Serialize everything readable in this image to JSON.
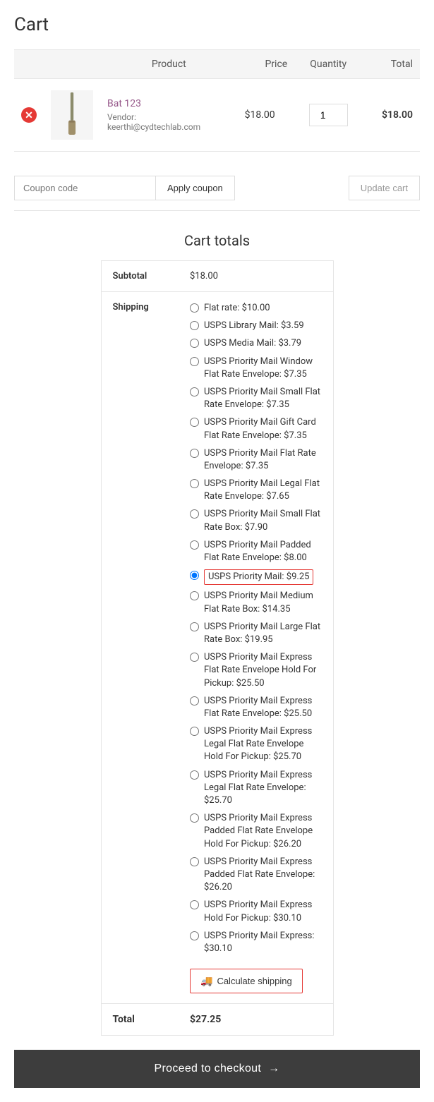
{
  "page": {
    "title": "Cart"
  },
  "table": {
    "headers": [
      "",
      "",
      "Product",
      "Price",
      "Quantity",
      "Total"
    ]
  },
  "cart_item": {
    "product_name": "Bat 123",
    "vendor_label": "Vendor:",
    "vendor_email": "keerthi@cydtechlab.com",
    "price": "$18.00",
    "quantity": "1",
    "total": "$18.00"
  },
  "coupon": {
    "placeholder": "Coupon code",
    "apply_label": "Apply coupon",
    "update_label": "Update cart"
  },
  "cart_totals": {
    "title": "Cart totals",
    "subtotal_label": "Subtotal",
    "subtotal_value": "$18.00",
    "shipping_label": "Shipping",
    "total_label": "Total",
    "total_value": "$27.25"
  },
  "shipping_options": [
    {
      "id": "flat_rate",
      "label": "Flat rate: $10.00",
      "selected": false
    },
    {
      "id": "usps_library",
      "label": "USPS Library Mail: $3.59",
      "selected": false
    },
    {
      "id": "usps_media",
      "label": "USPS Media Mail: $3.79",
      "selected": false
    },
    {
      "id": "usps_pw_flat_env",
      "label": "USPS Priority Mail Window Flat Rate Envelope: $7.35",
      "selected": false
    },
    {
      "id": "usps_small_flat_env",
      "label": "USPS Priority Mail Small Flat Rate Envelope: $7.35",
      "selected": false
    },
    {
      "id": "usps_gift_flat_env",
      "label": "USPS Priority Mail Gift Card Flat Rate Envelope: $7.35",
      "selected": false
    },
    {
      "id": "usps_flat_env",
      "label": "USPS Priority Mail Flat Rate Envelope: $7.35",
      "selected": false
    },
    {
      "id": "usps_legal_flat_env",
      "label": "USPS Priority Mail Legal Flat Rate Envelope: $7.65",
      "selected": false
    },
    {
      "id": "usps_small_flat_box",
      "label": "USPS Priority Mail Small Flat Rate Box: $7.90",
      "selected": false
    },
    {
      "id": "usps_padded_flat_env",
      "label": "USPS Priority Mail Padded Flat Rate Envelope: $8.00",
      "selected": false
    },
    {
      "id": "usps_priority",
      "label": "USPS Priority Mail: $9.25",
      "selected": true
    },
    {
      "id": "usps_medium_flat_box",
      "label": "USPS Priority Mail Medium Flat Rate Box: $14.35",
      "selected": false
    },
    {
      "id": "usps_large_flat_box",
      "label": "USPS Priority Mail Large Flat Rate Box: $19.95",
      "selected": false
    },
    {
      "id": "usps_express_flat_env_hold",
      "label": "USPS Priority Mail Express Flat Rate Envelope Hold For Pickup: $25.50",
      "selected": false
    },
    {
      "id": "usps_express_flat_env",
      "label": "USPS Priority Mail Express Flat Rate Envelope: $25.50",
      "selected": false
    },
    {
      "id": "usps_express_legal_hold",
      "label": "USPS Priority Mail Express Legal Flat Rate Envelope Hold For Pickup: $25.70",
      "selected": false
    },
    {
      "id": "usps_express_legal",
      "label": "USPS Priority Mail Express Legal Flat Rate Envelope: $25.70",
      "selected": false
    },
    {
      "id": "usps_express_padded_hold",
      "label": "USPS Priority Mail Express Padded Flat Rate Envelope Hold For Pickup: $26.20",
      "selected": false
    },
    {
      "id": "usps_express_padded",
      "label": "USPS Priority Mail Express Padded Flat Rate Envelope: $26.20",
      "selected": false
    },
    {
      "id": "usps_express_hold",
      "label": "USPS Priority Mail Express Hold For Pickup: $30.10",
      "selected": false
    },
    {
      "id": "usps_express",
      "label": "USPS Priority Mail Express: $30.10",
      "selected": false
    }
  ],
  "calculate_shipping": {
    "label": "Calculate shipping"
  },
  "checkout": {
    "label": "Proceed to checkout",
    "arrow": "→"
  }
}
